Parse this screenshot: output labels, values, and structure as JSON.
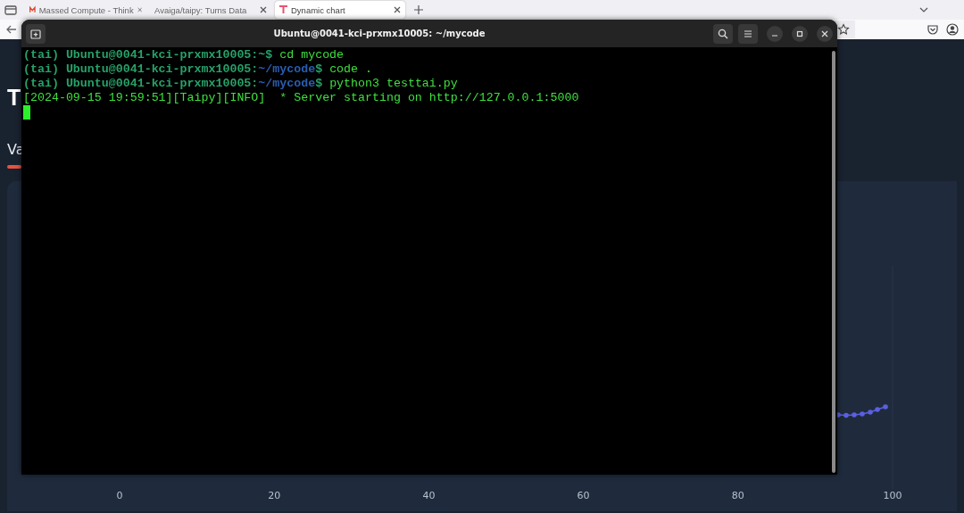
{
  "browser": {
    "tabs": [
      {
        "title": "Massed Compute - Think",
        "kind": "m",
        "selected": false
      },
      {
        "title": "Avaiga/taipy: Turns Data",
        "kind": "plain",
        "selected": false
      },
      {
        "title": "Dynamic chart",
        "kind": "t",
        "selected": true
      }
    ]
  },
  "page": {
    "heading": "T",
    "subtitle": "Va",
    "chart": {
      "x_ticks": [
        "0",
        "20",
        "40",
        "60",
        "80",
        "100"
      ]
    }
  },
  "terminal": {
    "title": "Ubuntu@0041-kci-prxmx10005: ~/mycode",
    "lines": [
      {
        "segments": [
          {
            "kind": "prompt",
            "text": "(tai) Ubuntu@0041-kci-prxmx10005:~$"
          },
          {
            "kind": "command",
            "text": " cd mycode"
          }
        ]
      },
      {
        "segments": [
          {
            "kind": "prompt",
            "text": "(tai) Ubuntu@0041-kci-prxmx10005:"
          },
          {
            "kind": "path",
            "text": "~/mycode"
          },
          {
            "kind": "prompt",
            "text": "$"
          },
          {
            "kind": "command",
            "text": " code ."
          }
        ]
      },
      {
        "segments": [
          {
            "kind": "prompt",
            "text": "(tai) Ubuntu@0041-kci-prxmx10005:"
          },
          {
            "kind": "path",
            "text": "~/mycode"
          },
          {
            "kind": "prompt",
            "text": "$"
          },
          {
            "kind": "command",
            "text": " python3 testtai.py"
          }
        ]
      },
      {
        "segments": [
          {
            "kind": "output",
            "text": "[2024-09-15 19:59:51][Taipy][INFO]  * Server starting on http://127.0.0.1:5000"
          }
        ]
      }
    ]
  }
}
